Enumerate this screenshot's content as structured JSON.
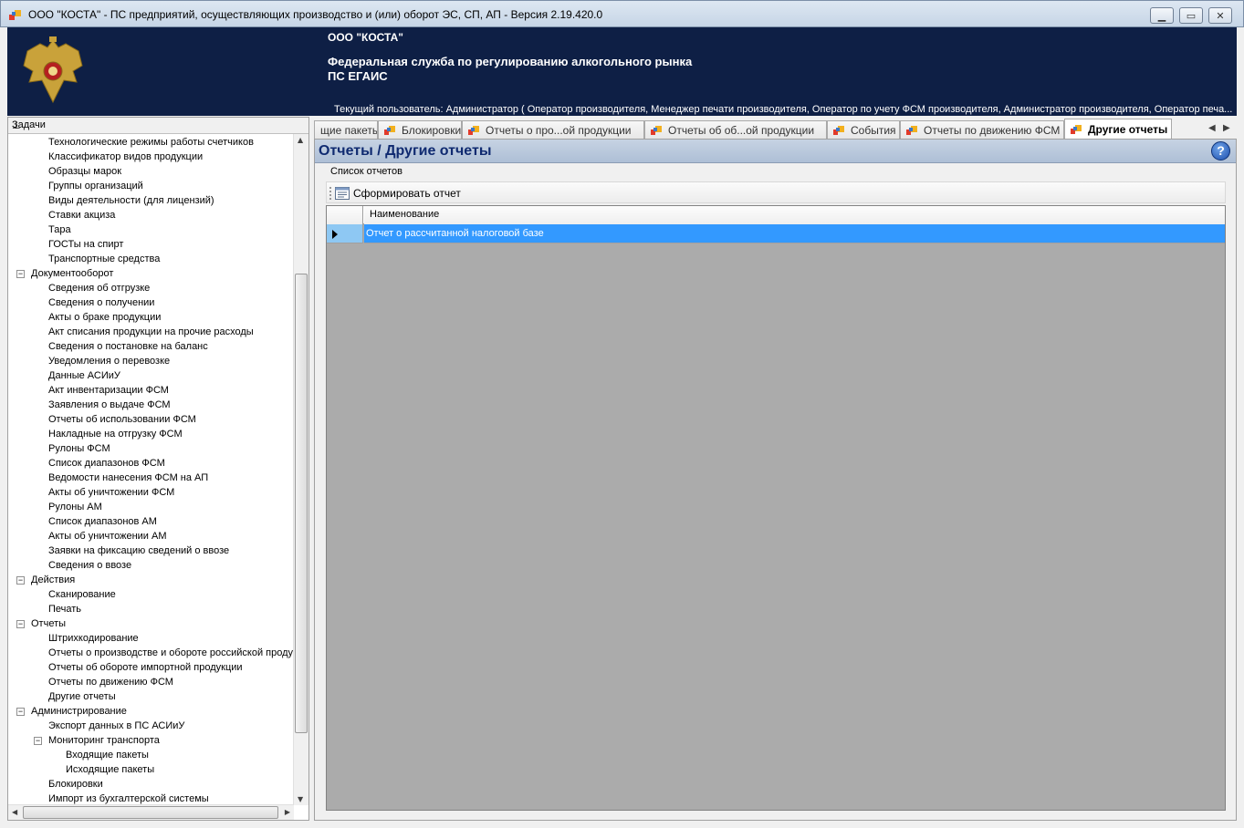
{
  "window": {
    "title": "ООО \"КОСТА\" - ПС предприятий, осуществляющих производство и (или) оборот ЭС, СП, АП - Версия 2.19.420.0",
    "min_glyph": "▁",
    "max_glyph": "▭",
    "close_glyph": "✕"
  },
  "banner": {
    "org": "ООО \"КОСТА\"",
    "service_line1": "Федеральная служба по регулированию алкогольного рынка",
    "service_line2": "ПС ЕГАИС",
    "user_line": "Текущий пользователь: Администратор ( Оператор производителя, Менеджер печати производителя, Оператор по учету ФСМ производителя, Администратор производителя, Оператор печа..."
  },
  "tasks": {
    "title": "Задачи",
    "pin_glyph": "⊥",
    "tree": [
      {
        "label": "Технологические режимы работы счетчиков",
        "level": 2
      },
      {
        "label": "Классификатор видов продукции",
        "level": 2
      },
      {
        "label": "Образцы марок",
        "level": 2
      },
      {
        "label": "Группы организаций",
        "level": 2
      },
      {
        "label": "Виды деятельности (для лицензий)",
        "level": 2
      },
      {
        "label": "Ставки акциза",
        "level": 2
      },
      {
        "label": "Тара",
        "level": 2
      },
      {
        "label": "ГОСТы на спирт",
        "level": 2
      },
      {
        "label": "Транспортные средства",
        "level": 2
      },
      {
        "label": "Документооборот",
        "level": 1,
        "expanded": true
      },
      {
        "label": "Сведения об отгрузке",
        "level": 2
      },
      {
        "label": "Сведения о получении",
        "level": 2
      },
      {
        "label": "Акты о браке продукции",
        "level": 2
      },
      {
        "label": "Акт списания продукции на прочие расходы",
        "level": 2
      },
      {
        "label": "Сведения о постановке на баланс",
        "level": 2
      },
      {
        "label": "Уведомления о перевозке",
        "level": 2
      },
      {
        "label": "Данные АСИиУ",
        "level": 2
      },
      {
        "label": "Акт инвентаризации ФСМ",
        "level": 2
      },
      {
        "label": "Заявления о выдаче ФСМ",
        "level": 2
      },
      {
        "label": "Отчеты об использовании ФСМ",
        "level": 2
      },
      {
        "label": "Накладные на отгрузку ФСМ",
        "level": 2
      },
      {
        "label": "Рулоны ФСМ",
        "level": 2
      },
      {
        "label": "Список диапазонов ФСМ",
        "level": 2
      },
      {
        "label": "Ведомости нанесения ФСМ на АП",
        "level": 2
      },
      {
        "label": "Акты об уничтожении ФСМ",
        "level": 2
      },
      {
        "label": "Рулоны АМ",
        "level": 2
      },
      {
        "label": "Список диапазонов АМ",
        "level": 2
      },
      {
        "label": "Акты об уничтожении АМ",
        "level": 2
      },
      {
        "label": "Заявки на фиксацию сведений о ввозе",
        "level": 2
      },
      {
        "label": "Сведения о ввозе",
        "level": 2
      },
      {
        "label": "Действия",
        "level": 1,
        "expanded": true
      },
      {
        "label": "Сканирование",
        "level": 2
      },
      {
        "label": "Печать",
        "level": 2
      },
      {
        "label": "Отчеты",
        "level": 1,
        "expanded": true
      },
      {
        "label": "Штрихкодирование",
        "level": 2
      },
      {
        "label": "Отчеты о производстве и обороте российской проду",
        "level": 2
      },
      {
        "label": "Отчеты об обороте импортной продукции",
        "level": 2
      },
      {
        "label": "Отчеты по движению ФСМ",
        "level": 2
      },
      {
        "label": "Другие отчеты",
        "level": 2
      },
      {
        "label": "Администрирование",
        "level": 1,
        "expanded": true
      },
      {
        "label": "Экспорт данных в ПС АСИиУ",
        "level": 2
      },
      {
        "label": "Мониторинг транспорта",
        "level": 2,
        "expanded": true
      },
      {
        "label": "Входящие пакеты",
        "level": 3
      },
      {
        "label": "Исходящие пакеты",
        "level": 3
      },
      {
        "label": "Блокировки",
        "level": 2
      },
      {
        "label": "Импорт из бухгалтерской системы",
        "level": 2
      }
    ]
  },
  "tabs": [
    {
      "label": "щие пакеты",
      "icon": false
    },
    {
      "label": "Блокировки",
      "icon": true
    },
    {
      "label": "Отчеты о про...ой продукции",
      "icon": true
    },
    {
      "label": "Отчеты об об...ой продукции",
      "icon": true
    },
    {
      "label": "События",
      "icon": true
    },
    {
      "label": "Отчеты по движению ФСМ",
      "icon": true
    },
    {
      "label": "Другие отчеты",
      "icon": true,
      "active": true
    }
  ],
  "tab_scroll": {
    "left_glyph": "◀",
    "right_glyph": "▶"
  },
  "content": {
    "title": "Отчеты / Другие отчеты",
    "help_glyph": "?",
    "group_label": "Список отчетов",
    "toolbar": {
      "generate_label": "Сформировать отчет"
    },
    "grid": {
      "column_header": "Наименование",
      "rows": [
        "Отчет о рассчитанной налоговой базе"
      ]
    }
  },
  "colors": {
    "banner_bg": "#0e1f45",
    "title_text": "#0f2a70",
    "selection": "#3399ff",
    "grid_bg": "#ababab"
  }
}
